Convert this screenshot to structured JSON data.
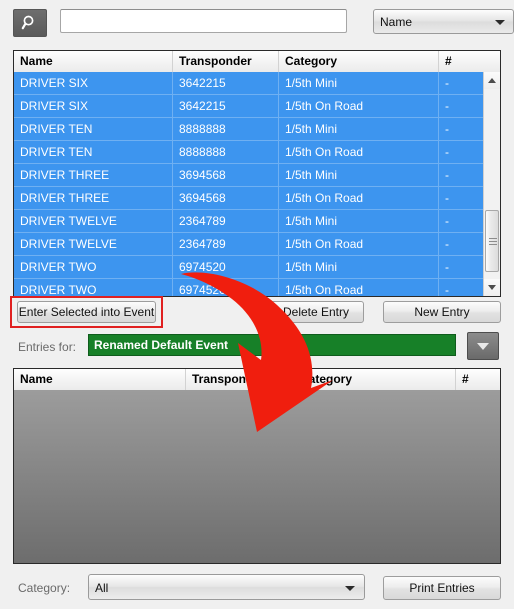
{
  "search": {
    "icon": "search-icon",
    "input_value": "",
    "placeholder": "",
    "field_selector_value": "Name"
  },
  "drivers_grid": {
    "columns": [
      "Name",
      "Transponder",
      "Category",
      "#"
    ],
    "rows": [
      [
        "DRIVER SIX",
        "3642215",
        "1/5th Mini",
        "-"
      ],
      [
        "DRIVER SIX",
        "3642215",
        "1/5th On Road",
        "-"
      ],
      [
        "DRIVER TEN",
        "8888888",
        "1/5th Mini",
        "-"
      ],
      [
        "DRIVER TEN",
        "8888888",
        "1/5th On Road",
        "-"
      ],
      [
        "DRIVER THREE",
        "3694568",
        "1/5th Mini",
        "-"
      ],
      [
        "DRIVER THREE",
        "3694568",
        "1/5th On Road",
        "-"
      ],
      [
        "DRIVER TWELVE",
        "2364789",
        "1/5th Mini",
        "-"
      ],
      [
        "DRIVER TWELVE",
        "2364789",
        "1/5th On Road",
        "-"
      ],
      [
        "DRIVER TWO",
        "6974520",
        "1/5th Mini",
        "-"
      ],
      [
        "DRIVER TWO",
        "6974520",
        "1/5th On Road",
        "-"
      ]
    ]
  },
  "actions": {
    "enter_selected": "Enter Selected into Event",
    "delete_entry": "Delete Entry",
    "new_entry": "New Entry",
    "print_entries": "Print Entries"
  },
  "entries": {
    "label": "Entries for:",
    "event_name": "Renamed Default Event",
    "dropdown_icon": "chevron-down-icon"
  },
  "entries_grid": {
    "columns": [
      "Name",
      "Transponder",
      "Category",
      "#"
    ],
    "rows": []
  },
  "category_filter": {
    "label": "Category:",
    "value": "All"
  },
  "annotations": {
    "highlight_target": "Enter Selected into Event",
    "arrow_color": "#f01e0e",
    "highlight_color": "#e02020"
  },
  "colors": {
    "selection_blue": "#3d95ef",
    "event_green": "#178028",
    "window_background": "#f0f0f0"
  }
}
